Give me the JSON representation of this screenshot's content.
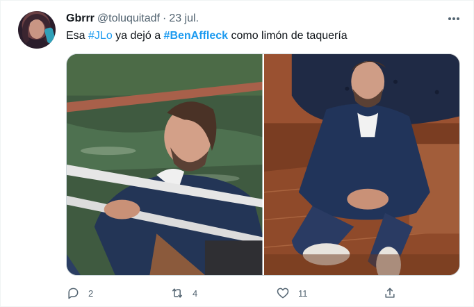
{
  "tweet": {
    "author_name": "Gbrrr",
    "handle": "@toluquitadf",
    "separator": "·",
    "date": "23 jul.",
    "text_parts": {
      "p1": "Esa ",
      "tag1": "#JLo",
      "p2": " ya dejó a ",
      "tag2": "#BenAffleck",
      "p3": " como limón de taquería"
    },
    "photos": [
      {
        "description_icon": "photo"
      },
      {
        "description_icon": "photo"
      }
    ],
    "actions": {
      "reply_count": "2",
      "retweet_count": "4",
      "like_count": "11"
    }
  },
  "colors": {
    "link": "#1d9bf0",
    "secondary_text": "#536471",
    "primary_text": "#0f1419"
  },
  "icons": {
    "more": "more-horizontal-icon",
    "reply": "reply-icon",
    "retweet": "retweet-icon",
    "like": "heart-icon",
    "share": "share-icon"
  }
}
